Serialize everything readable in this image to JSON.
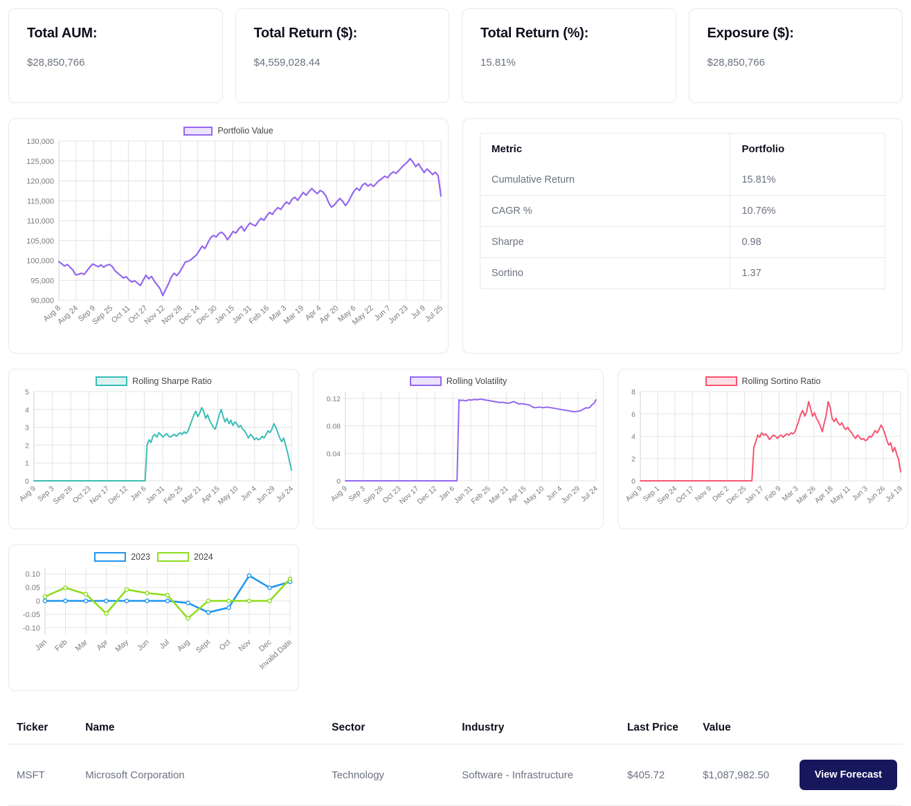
{
  "kpis": [
    {
      "title": "Total AUM:",
      "value": "$28,850,766"
    },
    {
      "title": "Total Return ($):",
      "value": "$4,559,028.44"
    },
    {
      "title": "Total Return (%):",
      "value": "15.81%"
    },
    {
      "title": "Exposure ($):",
      "value": "$28,850,766"
    }
  ],
  "metrics_table": {
    "headers": [
      "Metric",
      "Portfolio"
    ],
    "rows": [
      [
        "Cumulative Return",
        "15.81%"
      ],
      [
        "CAGR %",
        "10.76%"
      ],
      [
        "Sharpe",
        "0.98"
      ],
      [
        "Sortino",
        "1.37"
      ]
    ]
  },
  "holdings": {
    "headers": [
      "Ticker",
      "Name",
      "Sector",
      "Industry",
      "Last Price",
      "Value",
      ""
    ],
    "rows": [
      {
        "ticker": "MSFT",
        "name": "Microsoft Corporation",
        "sector": "Technology",
        "industry": "Software - Infrastructure",
        "last_price": "$405.72",
        "value": "$1,087,982.50",
        "action_label": "View Forecast"
      }
    ]
  },
  "colors": {
    "portfolio_purple": "#9366f0",
    "sharpe_teal": "#39bcb6",
    "volatility_purple": "#9366f0",
    "sortino_pink": "#f7536f",
    "series_2023_blue": "#1f97ef",
    "series_2024_green": "#8ddd1c",
    "button_navy": "#16175c"
  },
  "chart_data": [
    {
      "id": "portfolio_value",
      "type": "line",
      "title": "",
      "legend": [
        "Portfolio Value"
      ],
      "legend_position": "top-center",
      "grid": true,
      "xlabel": "",
      "ylabel": "",
      "ylim": [
        90000,
        130000
      ],
      "yticks": [
        "90,000",
        "95,000",
        "100,000",
        "105,000",
        "110,000",
        "115,000",
        "120,000",
        "125,000",
        "130,000"
      ],
      "xticks": [
        "Aug 8",
        "Aug 24",
        "Sep 9",
        "Sep 25",
        "Oct 11",
        "Oct 27",
        "Nov 12",
        "Nov 28",
        "Dec 14",
        "Dec 30",
        "Jan 15",
        "Jan 31",
        "Feb 16",
        "Mar 3",
        "Mar 19",
        "Apr 4",
        "Apr 20",
        "May 6",
        "May 22",
        "Jun 7",
        "Jun 23",
        "Jul 9",
        "Jul 25"
      ],
      "series": [
        {
          "name": "Portfolio Value",
          "color": "#9366f0",
          "values": [
            99700,
            99200,
            98600,
            99000,
            98300,
            97600,
            96400,
            96500,
            96800,
            96500,
            97400,
            98300,
            99100,
            98800,
            98400,
            98900,
            98300,
            98800,
            99000,
            98500,
            97400,
            96800,
            96200,
            95600,
            95900,
            95100,
            94600,
            94900,
            94300,
            93700,
            95000,
            96300,
            95400,
            96000,
            94800,
            93900,
            92900,
            91200,
            92700,
            94100,
            95800,
            96800,
            96200,
            97100,
            98300,
            99600,
            99800,
            100200,
            100800,
            101400,
            102500,
            103600,
            103000,
            104400,
            105700,
            106300,
            105900,
            106800,
            107100,
            106400,
            105200,
            106200,
            107300,
            106900,
            107900,
            108600,
            107400,
            108500,
            109400,
            109000,
            108700,
            109800,
            110600,
            110100,
            111200,
            112100,
            111600,
            112600,
            113300,
            112800,
            113900,
            114700,
            114200,
            115400,
            115900,
            115100,
            116200,
            117100,
            116400,
            117300,
            118100,
            117400,
            116800,
            117600,
            117200,
            116300,
            114600,
            113400,
            113900,
            114800,
            115600,
            114900,
            113800,
            114700,
            116100,
            117400,
            118200,
            117600,
            118900,
            119400,
            118700,
            119200,
            118600,
            119400,
            120100,
            120600,
            121200,
            120800,
            121700,
            122300,
            121900,
            122600,
            123400,
            124100,
            124700,
            125600,
            124800,
            123600,
            124300,
            123200,
            122100,
            123000,
            122400,
            121600,
            122200,
            121300,
            116200
          ]
        }
      ]
    },
    {
      "id": "rolling_sharpe",
      "type": "line",
      "legend": [
        "Rolling Sharpe Ratio"
      ],
      "grid": true,
      "ylim": [
        0,
        5
      ],
      "yticks": [
        "0",
        "1",
        "2",
        "3",
        "4",
        "5"
      ],
      "xticks": [
        "Aug 9",
        "Sep 3",
        "Sep 28",
        "Oct 23",
        "Nov 17",
        "Dec 12",
        "Jan 6",
        "Jan 31",
        "Feb 25",
        "Mar 21",
        "Apr 15",
        "May 10",
        "Jun 4",
        "Jun 29",
        "Jul 24"
      ],
      "series": [
        {
          "name": "Rolling Sharpe Ratio",
          "color": "#39bcb6",
          "values": [
            0,
            0,
            0,
            0,
            0,
            0,
            0,
            0,
            0,
            0,
            0,
            0,
            0,
            0,
            0,
            0,
            0,
            0,
            0,
            0,
            0,
            0,
            0,
            0,
            0,
            0,
            0,
            0,
            0,
            0,
            0,
            0,
            0,
            0,
            0,
            0,
            0,
            0,
            0,
            0,
            0,
            0,
            0,
            0,
            0,
            0,
            0,
            0,
            0,
            0,
            0,
            0,
            0,
            0,
            0,
            0,
            0,
            0,
            2.0,
            2.3,
            2.15,
            2.5,
            2.6,
            2.45,
            2.7,
            2.6,
            2.45,
            2.55,
            2.65,
            2.5,
            2.45,
            2.55,
            2.6,
            2.5,
            2.6,
            2.7,
            2.6,
            2.75,
            2.65,
            2.8,
            3.1,
            3.4,
            3.7,
            3.9,
            3.6,
            3.8,
            4.1,
            3.9,
            3.5,
            3.7,
            3.4,
            3.2,
            3.0,
            2.9,
            3.3,
            3.7,
            4.0,
            3.6,
            3.3,
            3.5,
            3.2,
            3.4,
            3.1,
            3.3,
            3.2,
            3.0,
            3.1,
            2.9,
            2.8,
            2.6,
            2.4,
            2.6,
            2.5,
            2.3,
            2.4,
            2.3,
            2.35,
            2.5,
            2.4,
            2.6,
            2.8,
            2.7,
            2.9,
            3.2,
            3.0,
            2.7,
            2.4,
            2.2,
            2.4,
            2.0,
            1.6,
            1.1,
            0.6
          ]
        }
      ]
    },
    {
      "id": "rolling_volatility",
      "type": "line",
      "legend": [
        "Rolling Volatility"
      ],
      "grid": true,
      "ylim": [
        0,
        0.13
      ],
      "yticks": [
        "0",
        "0.04",
        "0.08",
        "0.12"
      ],
      "xticks": [
        "Aug 9",
        "Sep 3",
        "Sep 28",
        "Oct 23",
        "Nov 17",
        "Dec 12",
        "Jan 6",
        "Jan 31",
        "Feb 25",
        "Mar 21",
        "Apr 15",
        "May 10",
        "Jun 4",
        "Jun 29",
        "Jul 24"
      ],
      "series": [
        {
          "name": "Rolling Volatility",
          "color": "#9366f0",
          "values": [
            0,
            0,
            0,
            0,
            0,
            0,
            0,
            0,
            0,
            0,
            0,
            0,
            0,
            0,
            0,
            0,
            0,
            0,
            0,
            0,
            0,
            0,
            0,
            0,
            0,
            0,
            0,
            0,
            0,
            0,
            0,
            0,
            0,
            0,
            0,
            0,
            0,
            0,
            0,
            0,
            0,
            0,
            0,
            0,
            0,
            0,
            0,
            0,
            0,
            0,
            0,
            0,
            0,
            0,
            0,
            0,
            0,
            0,
            0.118,
            0.117,
            0.1175,
            0.1165,
            0.117,
            0.118,
            0.1175,
            0.118,
            0.1185,
            0.118,
            0.1185,
            0.119,
            0.1185,
            0.118,
            0.1175,
            0.117,
            0.1165,
            0.116,
            0.1155,
            0.115,
            0.1145,
            0.114,
            0.1145,
            0.114,
            0.1135,
            0.113,
            0.1135,
            0.1145,
            0.1155,
            0.114,
            0.1125,
            0.112,
            0.1125,
            0.112,
            0.1115,
            0.111,
            0.1105,
            0.1085,
            0.107,
            0.1065,
            0.107,
            0.1075,
            0.107,
            0.1065,
            0.107,
            0.1075,
            0.107,
            0.1065,
            0.106,
            0.1055,
            0.105,
            0.1045,
            0.104,
            0.1035,
            0.103,
            0.1025,
            0.102,
            0.1015,
            0.101,
            0.1005,
            0.101,
            0.1015,
            0.102,
            0.1035,
            0.105,
            0.1065,
            0.106,
            0.1075,
            0.111,
            0.113,
            0.118
          ]
        }
      ]
    },
    {
      "id": "rolling_sortino",
      "type": "line",
      "legend": [
        "Rolling Sortino Ratio"
      ],
      "grid": true,
      "ylim": [
        0,
        8
      ],
      "yticks": [
        "0",
        "2",
        "4",
        "6",
        "8"
      ],
      "xticks": [
        "Aug 9",
        "Sep 1",
        "Sep 24",
        "Oct 17",
        "Nov 9",
        "Dec 2",
        "Dec 25",
        "Jan 17",
        "Feb 9",
        "Mar 3",
        "Mar 26",
        "Apr 18",
        "May 11",
        "Jun 3",
        "Jun 26",
        "Jul 19"
      ],
      "series": [
        {
          "name": "Rolling Sortino Ratio",
          "color": "#f7536f",
          "values": [
            0,
            0,
            0,
            0,
            0,
            0,
            0,
            0,
            0,
            0,
            0,
            0,
            0,
            0,
            0,
            0,
            0,
            0,
            0,
            0,
            0,
            0,
            0,
            0,
            0,
            0,
            0,
            0,
            0,
            0,
            0,
            0,
            0,
            0,
            0,
            0,
            0,
            0,
            0,
            0,
            0,
            0,
            0,
            0,
            0,
            0,
            0,
            0,
            0,
            0,
            0,
            0,
            0,
            0,
            0,
            0,
            0,
            0,
            3.0,
            3.5,
            4.1,
            3.9,
            4.3,
            4.1,
            4.2,
            4.0,
            3.7,
            3.9,
            4.1,
            4.0,
            3.8,
            4.0,
            4.1,
            3.9,
            4.1,
            4.2,
            4.1,
            4.3,
            4.2,
            4.4,
            4.9,
            5.4,
            6.0,
            6.3,
            5.8,
            6.2,
            7.1,
            6.5,
            5.8,
            6.1,
            5.6,
            5.3,
            4.9,
            4.4,
            5.2,
            5.9,
            7.1,
            6.6,
            5.6,
            5.3,
            5.6,
            5.2,
            5.0,
            5.2,
            4.8,
            4.6,
            4.8,
            4.5,
            4.3,
            4.0,
            3.8,
            4.1,
            3.9,
            3.7,
            3.8,
            3.6,
            3.7,
            4.0,
            3.9,
            4.2,
            4.5,
            4.3,
            4.6,
            5.0,
            4.7,
            4.2,
            3.6,
            3.2,
            3.4,
            2.6,
            3.0,
            2.4,
            1.9,
            0.8
          ]
        }
      ]
    },
    {
      "id": "monthly_returns",
      "type": "line",
      "legend": [
        "2023",
        "2024"
      ],
      "grid": true,
      "ylim": [
        -0.125,
        0.125
      ],
      "yticks": [
        "0.10",
        "0.05",
        "0",
        "-0.05",
        "-0.10"
      ],
      "categories": [
        "Jan",
        "Feb",
        "Mar",
        "Apr",
        "May",
        "Jun",
        "Jul",
        "Aug",
        "Sept",
        "Oct",
        "Nov",
        "Dec",
        "Invalid Date"
      ],
      "series": [
        {
          "name": "2023",
          "color": "#1f97ef",
          "values": [
            0,
            0,
            0,
            0,
            0,
            0,
            0,
            -0.008,
            -0.043,
            -0.025,
            0.094,
            0.049,
            0.071
          ]
        },
        {
          "name": "2024",
          "color": "#8ddd1c",
          "values": [
            0.016,
            0.049,
            0.025,
            -0.047,
            0.042,
            0.029,
            0.021,
            -0.065,
            0,
            0,
            0,
            0,
            0.082
          ]
        }
      ]
    }
  ]
}
